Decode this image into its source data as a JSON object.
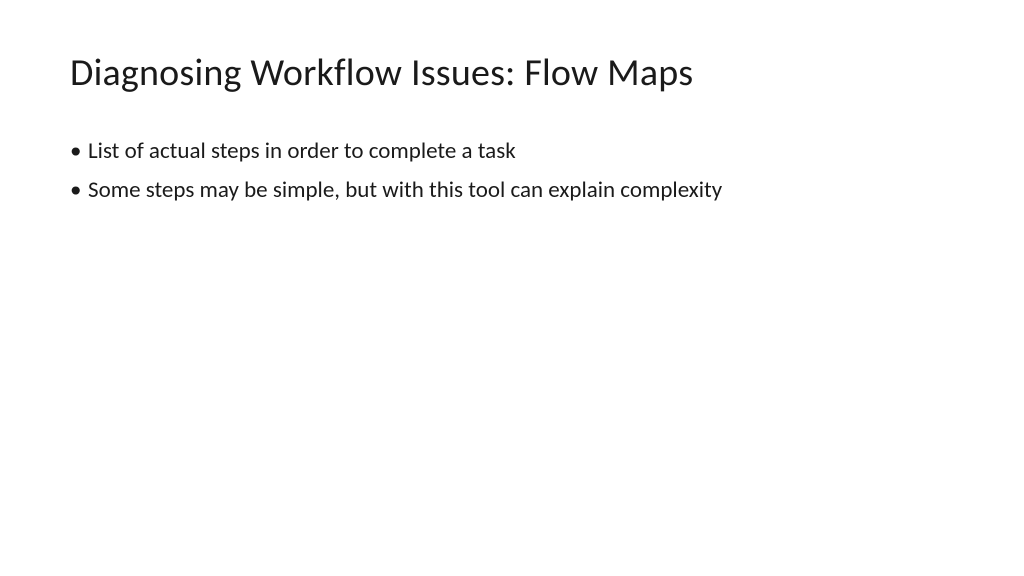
{
  "slide": {
    "title": "Diagnosing Workflow Issues: Flow Maps",
    "bullets": [
      "List of actual steps in order to complete a task",
      "Some steps may be simple, but with this tool can explain complexity"
    ]
  }
}
